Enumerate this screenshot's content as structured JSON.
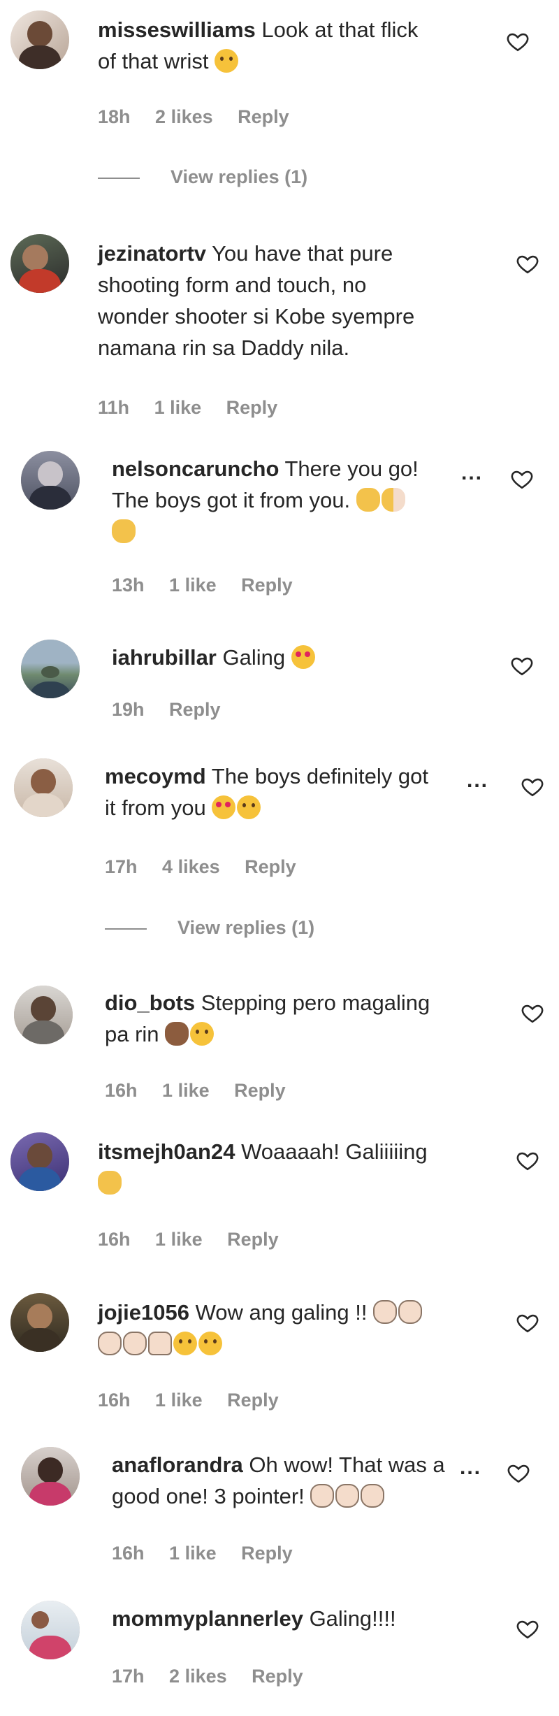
{
  "comments": [
    {
      "username": "misseswilliams",
      "text_line1": "Look at that flick",
      "text_line2": "of that wrist",
      "emojis": [
        "tongue-wink"
      ],
      "time": "18h",
      "likes": "2 likes",
      "reply": "Reply",
      "view_replies": "View replies (1)"
    },
    {
      "username": "jezinatortv",
      "text_line1": "You have that pure",
      "text_line2": "shooting form and touch, no",
      "text_line3": "wonder shooter si Kobe syempre",
      "text_line4": "namana rin sa Daddy nila.",
      "time": "11h",
      "likes": "1 like",
      "reply": "Reply"
    },
    {
      "username": "nelsoncaruncho",
      "text_line1": "There you go!",
      "text_line2": "The boys got it from you.",
      "emojis": [
        "clap",
        "clap-half",
        "clap"
      ],
      "more": "...",
      "time": "13h",
      "likes": "1 like",
      "reply": "Reply"
    },
    {
      "username": "iahrubillar",
      "text_line1": "Galing",
      "emojis": [
        "heart-eyes"
      ],
      "time": "19h",
      "reply": "Reply"
    },
    {
      "username": "mecoymd",
      "text_line1": "The boys definitely got",
      "text_line2": "it from you",
      "emojis": [
        "heart-eyes",
        "laughing"
      ],
      "more": "...",
      "time": "17h",
      "likes": "4 likes",
      "reply": "Reply",
      "view_replies": "View replies (1)"
    },
    {
      "username": "dio_bots",
      "text_line1": "Stepping pero magaling",
      "text_line2": "pa rin",
      "emojis": [
        "clap-dark",
        "grin"
      ],
      "time": "16h",
      "likes": "1 like",
      "reply": "Reply"
    },
    {
      "username": "itsmejh0an24",
      "text_line1": "Woaaaah! Galiiiiing",
      "emojis": [
        "clap"
      ],
      "time": "16h",
      "likes": "1 like",
      "reply": "Reply"
    },
    {
      "username": "jojie1056",
      "text_line1": "Wow ang galing !!",
      "emojis": [
        "clap-light",
        "clap-light",
        "clap-light",
        "clap-light",
        "raised-hands",
        "hug",
        "hug"
      ],
      "time": "16h",
      "likes": "1 like",
      "reply": "Reply"
    },
    {
      "username": "anaflorandra",
      "text_line1": "Oh wow! That was a",
      "text_line2": "good one! 3 pointer!",
      "emojis": [
        "clap-light",
        "clap-light",
        "clap-light"
      ],
      "more": "...",
      "time": "16h",
      "likes": "1 like",
      "reply": "Reply"
    },
    {
      "username": "mommyplannerley",
      "text_line1": "Galing!!!!",
      "time": "17h",
      "likes": "2 likes",
      "reply": "Reply"
    }
  ],
  "colors": {
    "text": "#262626",
    "meta": "#8e8e8e",
    "background": "#ffffff"
  },
  "icons": {
    "like": "heart-outline-icon",
    "more": "more-options-icon"
  }
}
